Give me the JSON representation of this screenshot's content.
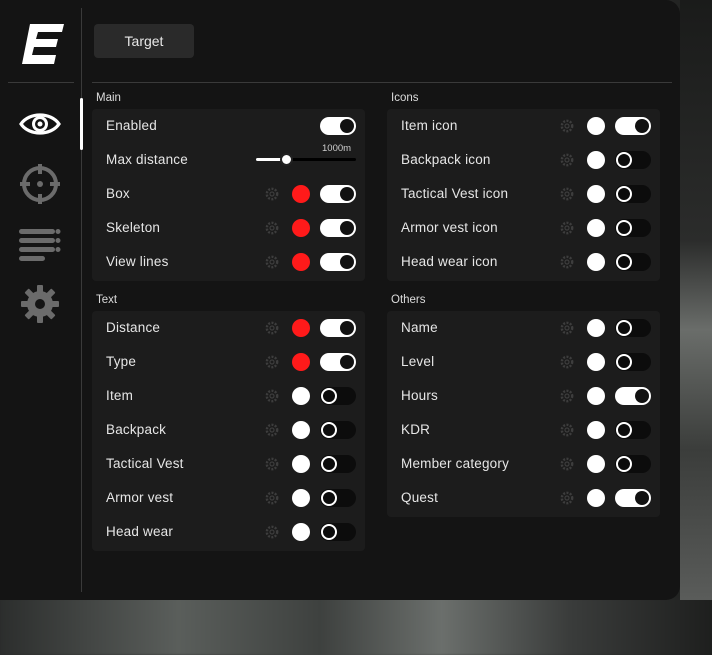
{
  "colors": {
    "accent_red": "#ff1a1a",
    "white": "#ffffff",
    "panel_bg": "#1c1c1c",
    "window_bg": "#141414"
  },
  "sidebar": {
    "logo": "e-logo",
    "items": [
      {
        "icon": "eye-icon",
        "active": true
      },
      {
        "icon": "crosshair-icon",
        "active": false
      },
      {
        "icon": "list-icon",
        "active": false
      },
      {
        "icon": "gear-icon",
        "active": false
      }
    ]
  },
  "header": {
    "tab_label": "Target"
  },
  "sections": {
    "main": {
      "title": "Main",
      "enabled": {
        "label": "Enabled",
        "toggle": true
      },
      "max_distance": {
        "label": "Max distance",
        "value_label": "1000m",
        "fraction": 0.25
      },
      "box": {
        "label": "Box",
        "color": "#ff1a1a",
        "toggle": true
      },
      "skeleton": {
        "label": "Skeleton",
        "color": "#ff1a1a",
        "toggle": true
      },
      "view_lines": {
        "label": "View lines",
        "color": "#ff1a1a",
        "toggle": true
      }
    },
    "icons": {
      "title": "Icons",
      "rows": [
        {
          "label": "Item icon",
          "color": "#ffffff",
          "toggle": true
        },
        {
          "label": "Backpack icon",
          "color": "#ffffff",
          "toggle": false
        },
        {
          "label": "Tactical Vest icon",
          "color": "#ffffff",
          "toggle": false
        },
        {
          "label": "Armor vest icon",
          "color": "#ffffff",
          "toggle": false
        },
        {
          "label": "Head wear icon",
          "color": "#ffffff",
          "toggle": false
        }
      ]
    },
    "text": {
      "title": "Text",
      "rows": [
        {
          "label": "Distance",
          "color": "#ff1a1a",
          "toggle": true
        },
        {
          "label": "Type",
          "color": "#ff1a1a",
          "toggle": true
        },
        {
          "label": "Item",
          "color": "#ffffff",
          "toggle": false
        },
        {
          "label": "Backpack",
          "color": "#ffffff",
          "toggle": false
        },
        {
          "label": "Tactical Vest",
          "color": "#ffffff",
          "toggle": false
        },
        {
          "label": "Armor vest",
          "color": "#ffffff",
          "toggle": false
        },
        {
          "label": "Head wear",
          "color": "#ffffff",
          "toggle": false
        }
      ]
    },
    "others": {
      "title": "Others",
      "rows": [
        {
          "label": "Name",
          "color": "#ffffff",
          "toggle": false
        },
        {
          "label": "Level",
          "color": "#ffffff",
          "toggle": false
        },
        {
          "label": "Hours",
          "color": "#ffffff",
          "toggle": true
        },
        {
          "label": "KDR",
          "color": "#ffffff",
          "toggle": false
        },
        {
          "label": "Member category",
          "color": "#ffffff",
          "toggle": false
        },
        {
          "label": "Quest",
          "color": "#ffffff",
          "toggle": true
        }
      ]
    }
  }
}
